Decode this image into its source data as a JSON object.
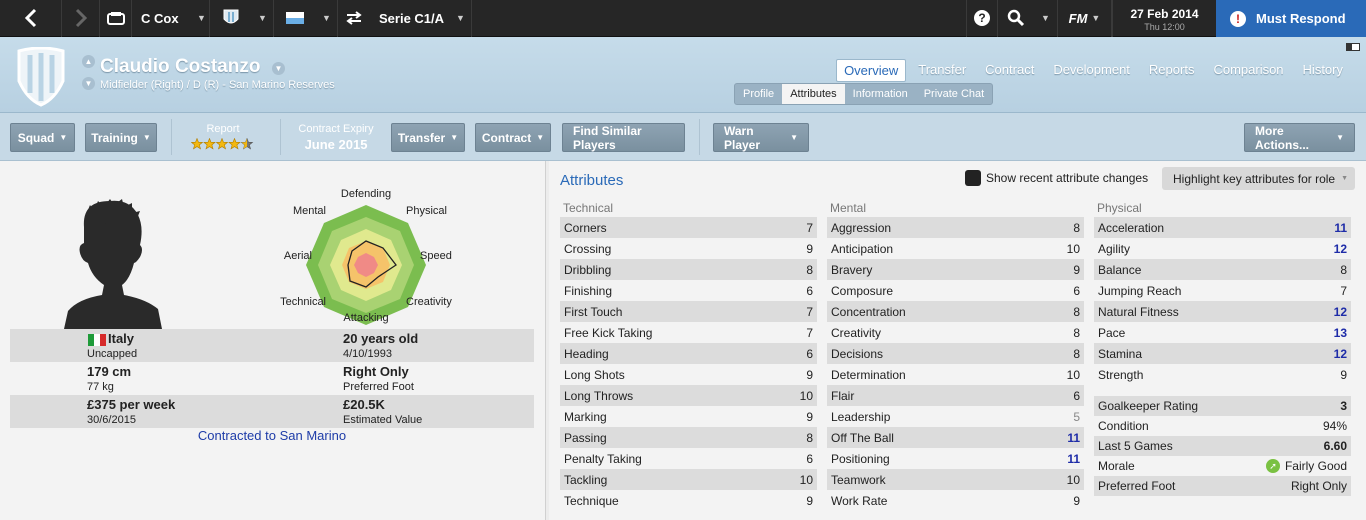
{
  "topbar": {
    "manager": "C Cox",
    "competition": "Serie C1/A",
    "date": "27 Feb 2014",
    "time": "Thu 12:00",
    "must_respond": "Must Respond",
    "fm_label": "FM"
  },
  "player": {
    "name": "Claudio Costanzo",
    "subtitle": "Midfielder (Right) / D (R) - San Marino Reserves"
  },
  "nav": {
    "tabs": [
      "Overview",
      "Transfer",
      "Contract",
      "Development",
      "Reports",
      "Comparison",
      "History"
    ],
    "subtabs": [
      "Profile",
      "Attributes",
      "Information",
      "Private Chat"
    ]
  },
  "toolbar": {
    "squad": "Squad",
    "training": "Training",
    "report_label": "Report",
    "report_stars": 4.5,
    "contract_expiry_label": "Contract Expiry",
    "contract_expiry_value": "June 2015",
    "transfer": "Transfer",
    "contract": "Contract",
    "find_similar": "Find Similar Players",
    "warn": "Warn Player",
    "more": "More Actions..."
  },
  "radar": {
    "labels": {
      "defending": "Defending",
      "physical": "Physical",
      "speed": "Speed",
      "creativity": "Creativity",
      "attacking": "Attacking",
      "technical": "Technical",
      "aerial": "Aerial",
      "mental": "Mental"
    }
  },
  "info": {
    "nationality": "Italy",
    "caps": "Uncapped",
    "age": "20 years old",
    "dob": "4/10/1993",
    "height": "179 cm",
    "weight": "77 kg",
    "foot_value": "Right Only",
    "foot_label": "Preferred Foot",
    "wage": "£375 per week",
    "contract_end": "30/6/2015",
    "value": "£20.5K",
    "value_label": "Estimated Value",
    "contracted_to": "Contracted to San Marino"
  },
  "attributes": {
    "title": "Attributes",
    "show_changes": "Show recent attribute changes",
    "highlight": "Highlight key attributes for role",
    "technical_header": "Technical",
    "mental_header": "Mental",
    "physical_header": "Physical",
    "technical": [
      [
        "Corners",
        "7"
      ],
      [
        "Crossing",
        "9"
      ],
      [
        "Dribbling",
        "8"
      ],
      [
        "Finishing",
        "6"
      ],
      [
        "First Touch",
        "7"
      ],
      [
        "Free Kick Taking",
        "7"
      ],
      [
        "Heading",
        "6"
      ],
      [
        "Long Shots",
        "9"
      ],
      [
        "Long Throws",
        "10"
      ],
      [
        "Marking",
        "9"
      ],
      [
        "Passing",
        "8"
      ],
      [
        "Penalty Taking",
        "6"
      ],
      [
        "Tackling",
        "10"
      ],
      [
        "Technique",
        "9"
      ]
    ],
    "mental": [
      [
        "Aggression",
        "8"
      ],
      [
        "Anticipation",
        "10"
      ],
      [
        "Bravery",
        "9"
      ],
      [
        "Composure",
        "6"
      ],
      [
        "Concentration",
        "8"
      ],
      [
        "Creativity",
        "8"
      ],
      [
        "Decisions",
        "8"
      ],
      [
        "Determination",
        "10"
      ],
      [
        "Flair",
        "6"
      ],
      [
        "Leadership",
        "5"
      ],
      [
        "Off The Ball",
        "11"
      ],
      [
        "Positioning",
        "11"
      ],
      [
        "Teamwork",
        "10"
      ],
      [
        "Work Rate",
        "9"
      ]
    ],
    "physical": [
      [
        "Acceleration",
        "11"
      ],
      [
        "Agility",
        "12"
      ],
      [
        "Balance",
        "8"
      ],
      [
        "Jumping Reach",
        "7"
      ],
      [
        "Natural Fitness",
        "12"
      ],
      [
        "Pace",
        "13"
      ],
      [
        "Stamina",
        "12"
      ],
      [
        "Strength",
        "9"
      ]
    ],
    "extra": [
      [
        "Goalkeeper Rating",
        "3"
      ],
      [
        "Condition",
        "94%"
      ],
      [
        "Last 5 Games",
        "6.60"
      ],
      [
        "Morale",
        "Fairly Good"
      ],
      [
        "Preferred Foot",
        "Right Only"
      ]
    ]
  }
}
